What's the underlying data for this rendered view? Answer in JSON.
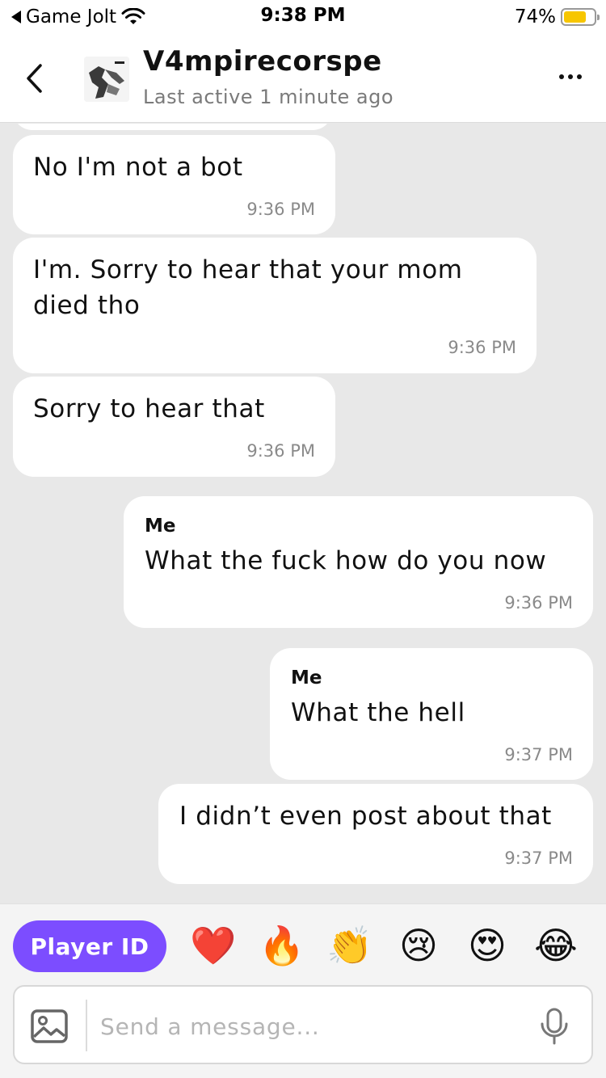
{
  "status_bar": {
    "back_app": "Game Jolt",
    "time": "9:38 PM",
    "battery": "74%",
    "battery_level": 0.74
  },
  "header": {
    "name": "V4mpirecorspe",
    "status": "Last active 1 minute ago"
  },
  "messages": [
    {
      "from": "them",
      "text": "No I'm not a bot",
      "time": "9:36 PM"
    },
    {
      "from": "them",
      "text_line1": "I'm. Sorry to hear that your mom",
      "text_line2": "died tho",
      "time": "9:36 PM"
    },
    {
      "from": "them",
      "text": "Sorry to hear that",
      "time": "9:36 PM"
    },
    {
      "from": "me",
      "sender": "Me",
      "text": "What the fuck how do you now",
      "time": "9:36 PM"
    },
    {
      "from": "me",
      "sender": "Me",
      "text": "What the hell",
      "time": "9:37 PM"
    },
    {
      "from": "me",
      "text": "I didn’t even post about that",
      "time": "9:37 PM"
    }
  ],
  "quick_actions": {
    "player_id_label": "Player ID",
    "emojis": [
      "❤️",
      "🔥",
      "👏",
      "😢",
      "😍",
      "😂"
    ]
  },
  "composer": {
    "placeholder": "Send a message..."
  },
  "colors": {
    "accent": "#7c4dff",
    "background": "#e8e8e8",
    "bubble": "#ffffff"
  }
}
